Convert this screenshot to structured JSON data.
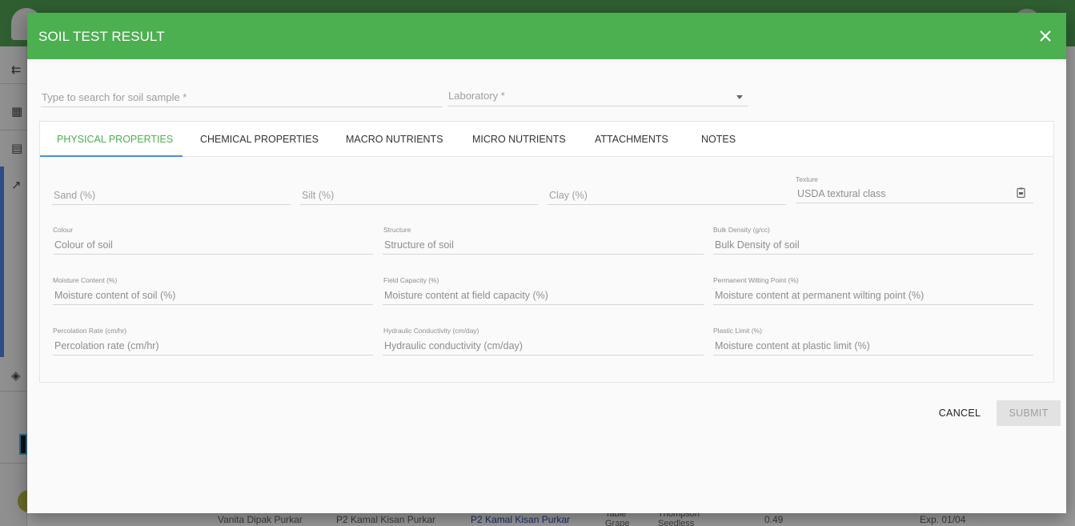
{
  "dialog": {
    "title": "SOIL TEST RESULT",
    "search_placeholder": "Type to search for soil sample *",
    "laboratory_placeholder": "Laboratory *",
    "cancel_label": "CANCEL",
    "submit_label": "SUBMIT"
  },
  "tabs": [
    {
      "label": "PHYSICAL PROPERTIES",
      "active": true
    },
    {
      "label": "CHEMICAL PROPERTIES",
      "active": false
    },
    {
      "label": "MACRO NUTRIENTS",
      "active": false
    },
    {
      "label": "MICRO NUTRIENTS",
      "active": false
    },
    {
      "label": "ATTACHMENTS",
      "active": false
    },
    {
      "label": "NOTES",
      "active": false
    }
  ],
  "physical": {
    "sand_placeholder": "Sand (%)",
    "silt_placeholder": "Silt (%)",
    "clay_placeholder": "Clay (%)",
    "texture_label": "Texture",
    "texture_placeholder": "USDA textural class",
    "colour_label": "Colour",
    "colour_placeholder": "Colour of soil",
    "structure_label": "Structure",
    "structure_placeholder": "Structure of soil",
    "bulk_density_label": "Bulk Density (g/cc)",
    "bulk_density_placeholder": "Bulk Density of soil",
    "moisture_label": "Moisture Content (%)",
    "moisture_placeholder": "Moisture content of soil (%)",
    "field_capacity_label": "Field Capacity (%)",
    "field_capacity_placeholder": "Moisture content at field capacity (%)",
    "pwp_label": "Permanent Wilting Point (%)",
    "pwp_placeholder": "Moisture content at permanent wilting point (%)",
    "percolation_label": "Percolation Rate (cm/hr)",
    "percolation_placeholder": "Percolation rate (cm/hr)",
    "hydraulic_label": "Hydraulic Conductivity (cm/day)",
    "hydraulic_placeholder": "Hydraulic conductivity (cm/day)",
    "plastic_label": "Plastic Limit (%)",
    "plastic_placeholder": "Moisture content at plastic limit (%)"
  },
  "background_row": {
    "col1": "Vanita Dipak Purkar",
    "col2": "P2 Kamal Kisan Purkar",
    "col3": "P2 Kamal Kisan Purkar",
    "col4": "Table Grape",
    "col5": "Thompson Seedless",
    "col6": "0.49",
    "col7": "Exp.  01/04"
  },
  "colors": {
    "header_green": "#4caf50",
    "active_tab_text": "#4caf50",
    "tab_indicator": "#4a90d9"
  }
}
